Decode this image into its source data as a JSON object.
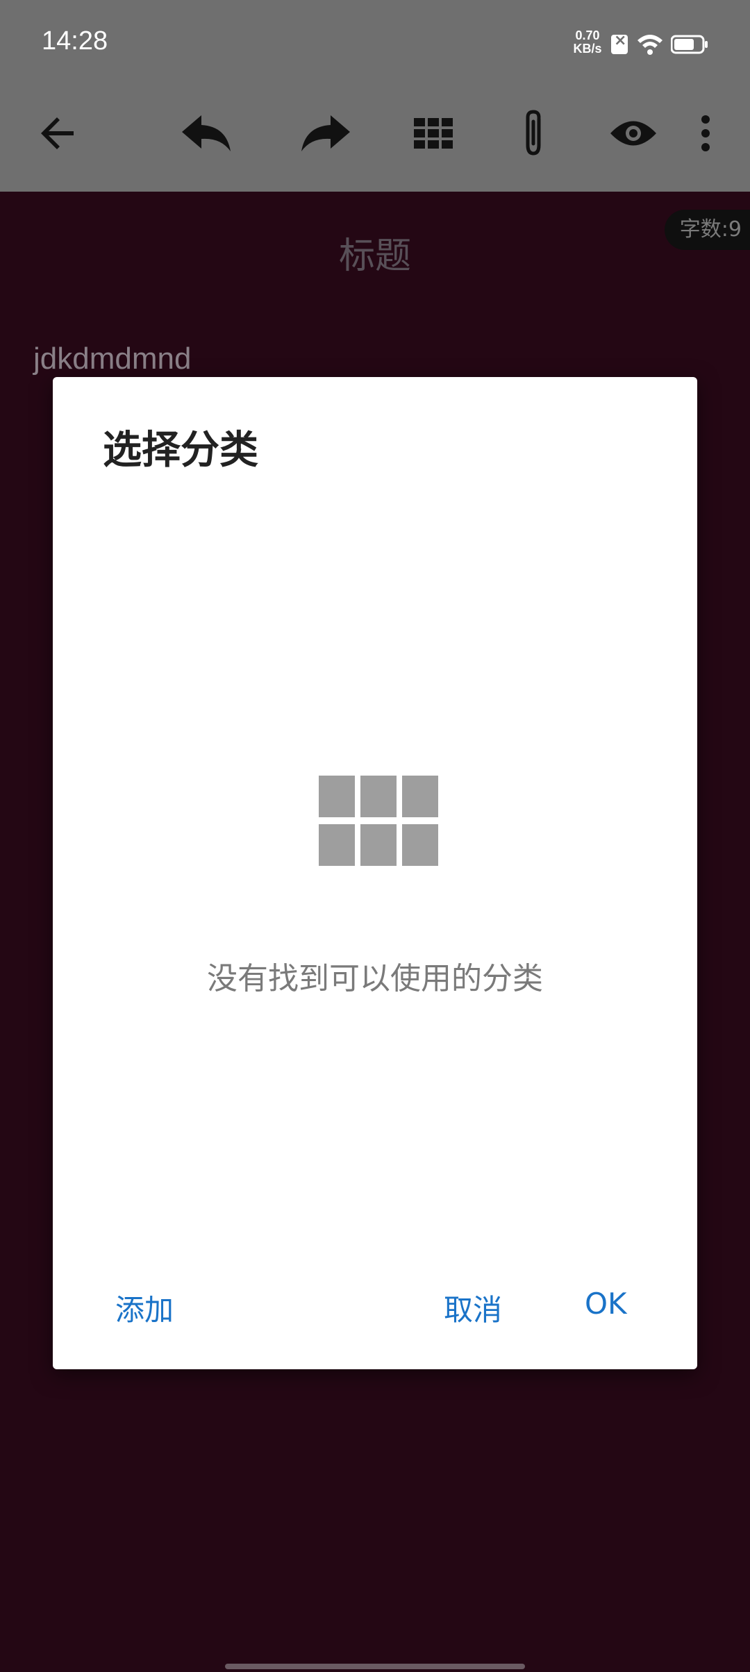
{
  "status_bar": {
    "time": "14:28",
    "net_speed_value": "0.70",
    "net_speed_unit": "KB/s"
  },
  "toolbar": {
    "icons": [
      "back-arrow-icon",
      "undo-icon",
      "redo-icon",
      "grid-icon",
      "attachment-icon",
      "preview-eye-icon",
      "more-vert-icon"
    ]
  },
  "editor": {
    "title_placeholder": "标题",
    "word_count": "字数:9",
    "body_text": "jdkdmdmnd"
  },
  "dialog": {
    "title": "选择分类",
    "empty_message": "没有找到可以使用的分类",
    "add_label": "添加",
    "cancel_label": "取消",
    "ok_label": "OK"
  },
  "colors": {
    "accent": "#1a73c8",
    "toolbar_bg": "#6f6f6f",
    "editor_bg": "#240714"
  }
}
